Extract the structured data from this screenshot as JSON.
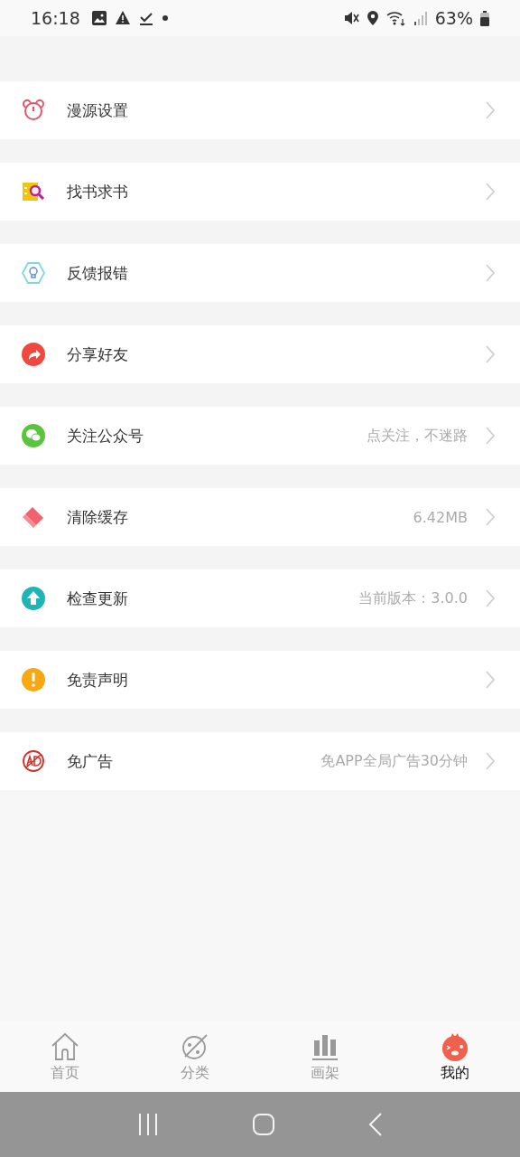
{
  "status_bar": {
    "time": "16:18",
    "battery": "63%"
  },
  "menu": [
    {
      "kind": "bear",
      "label": "漫源设置"
    },
    {
      "kind": "search-book",
      "label": "找书求书"
    },
    {
      "kind": "bulb",
      "label": "反馈报错"
    },
    {
      "kind": "share",
      "label": "分享好友"
    },
    {
      "kind": "chat",
      "label": "关注公众号",
      "value": "点关注，不迷路"
    },
    {
      "kind": "eraser",
      "label": "清除缓存",
      "value": "6.42MB"
    },
    {
      "kind": "upload",
      "label": "检查更新",
      "value": "当前版本：3.0.0"
    },
    {
      "kind": "alert",
      "label": "免责声明"
    },
    {
      "kind": "ad",
      "label": "免广告",
      "value": "免APP全局广告30分钟"
    }
  ],
  "tabs": [
    {
      "kind": "home",
      "label": "首页",
      "selected": false
    },
    {
      "kind": "planet",
      "label": "分类",
      "selected": false
    },
    {
      "kind": "shelf",
      "label": "画架",
      "selected": false
    },
    {
      "kind": "mascot",
      "label": "我的",
      "selected": true
    }
  ]
}
